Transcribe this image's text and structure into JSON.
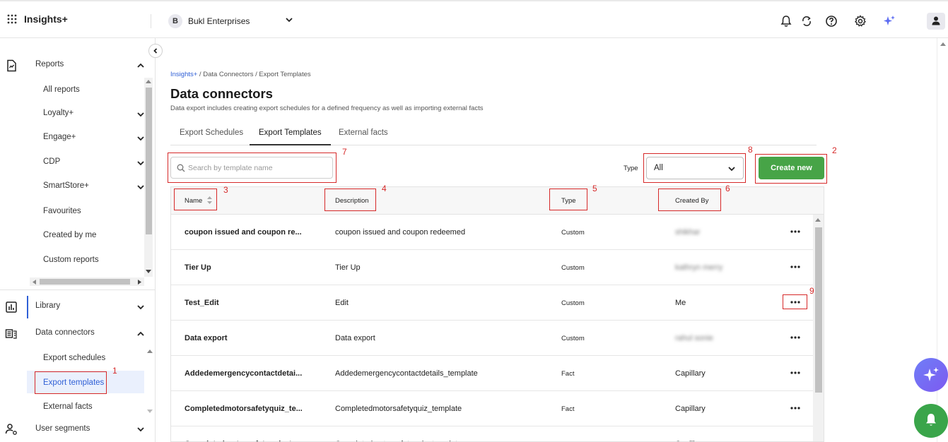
{
  "app": {
    "title": "Insights+"
  },
  "org": {
    "initial": "B",
    "name": "Bukl Enterprises"
  },
  "sidebar": {
    "reports_header": "Reports",
    "report_items": [
      {
        "label": "All reports"
      },
      {
        "label": "Loyalty+"
      },
      {
        "label": "Engage+"
      },
      {
        "label": "CDP"
      },
      {
        "label": "SmartStore+"
      },
      {
        "label": "Favourites"
      },
      {
        "label": "Created by me"
      },
      {
        "label": "Custom reports"
      }
    ],
    "library_header": "Library",
    "data_connectors_header": "Data connectors",
    "dc_items": [
      {
        "label": "Export schedules"
      },
      {
        "label": "Export templates"
      },
      {
        "label": "External facts"
      }
    ],
    "user_segments_header": "User segments"
  },
  "breadcrumb": {
    "root": "Insights+",
    "rest": " / Data Connectors / Export Templates"
  },
  "page": {
    "title": "Data connectors",
    "subtitle": "Data export includes creating export schedules for a defined frequency as well as importing external facts"
  },
  "tabs": [
    "Export Schedules",
    "Export Templates",
    "External facts"
  ],
  "search": {
    "placeholder": "Search by template name"
  },
  "filter": {
    "label": "Type",
    "value": "All"
  },
  "create_button": "Create new",
  "table": {
    "headers": {
      "name": "Name",
      "description": "Description",
      "type": "Type",
      "created_by": "Created By"
    },
    "rows": [
      {
        "name": "coupon issued and coupon re...",
        "description": "coupon issued and coupon redeemed",
        "type": "Custom",
        "created_by": "shikhar",
        "blurred": true
      },
      {
        "name": "Tier Up",
        "description": "Tier Up",
        "type": "Custom",
        "created_by": "kathryn merry",
        "blurred": true
      },
      {
        "name": "Test_Edit",
        "description": "Edit",
        "type": "Custom",
        "created_by": "Me",
        "blurred": false
      },
      {
        "name": "Data export",
        "description": "Data export",
        "type": "Custom",
        "created_by": "rahul sonie",
        "blurred": true
      },
      {
        "name": "Addedemergencycontactdetai...",
        "description": "Addedemergencycontactdetails_template",
        "type": "Fact",
        "created_by": "Capillary",
        "blurred": false
      },
      {
        "name": "Completedmotorsafetyquiz_te...",
        "description": "Completedmotorsafetyquiz_template",
        "type": "Fact",
        "created_by": "Capillary",
        "blurred": false
      },
      {
        "name": "Completedmotorsafetyquiz_te...",
        "description": "Completedmotorsafetyquiz_template",
        "type": "Fact",
        "created_by": "Capillary",
        "blurred": false
      }
    ]
  },
  "annotations": [
    "1",
    "2",
    "3",
    "4",
    "5",
    "6",
    "7",
    "8",
    "9"
  ],
  "colors": {
    "accent": "#2f5fd6",
    "create_green": "#47a447",
    "annotation_red": "#d62828"
  }
}
